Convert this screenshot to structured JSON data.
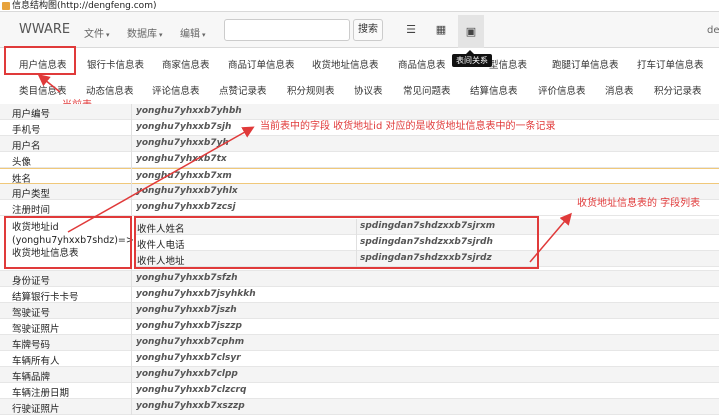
{
  "titlebar": {
    "title": "信息结构图(http://dengfeng.com)"
  },
  "navbar": {
    "brand": "WWARE",
    "menus": [
      "文件",
      "数据库",
      "编辑"
    ],
    "search_placeholder": "",
    "search_button": "搜索",
    "view_icons": [
      "list-icon",
      "grid-icon",
      "image-icon"
    ],
    "tooltip": "表间关系",
    "right_text": "de"
  },
  "tabs_row1": [
    "用户信息表",
    "银行卡信息表",
    "商家信息表",
    "商品订单信息表",
    "收货地址信息表",
    "商品信息表",
    "型信息表",
    "跑腿订单信息表",
    "打车订单信息表"
  ],
  "tabs_row2": [
    "类目信息表",
    "动态信息表",
    "评论信息表",
    "点赞记录表",
    "积分规则表",
    "协议表",
    "常见问题表",
    "结算信息表",
    "评价信息表",
    "消息表",
    "积分记录表"
  ],
  "annotations": {
    "current_table": "当前表",
    "field_note": "当前表中的字段 收货地址id 对应的是收货地址信息表中的一条记录",
    "field_list_note": "收货地址信息表的 字段列表"
  },
  "rows_top": [
    {
      "label": "用户编号",
      "value": "yonghu7yhxxb7yhbh"
    },
    {
      "label": "手机号",
      "value": "yonghu7yhxxb7sjh"
    },
    {
      "label": "用户名",
      "value": "yonghu7yhxxb7yh"
    },
    {
      "label": "头像",
      "value": "yonghu7yhxxb7tx"
    },
    {
      "label": "姓名",
      "value": "yonghu7yhxxb7xm"
    },
    {
      "label": "用户类型",
      "value": "yonghu7yhxxb7yhlx"
    },
    {
      "label": "注册时间",
      "value": "yonghu7yhxxb7zcsj"
    }
  ],
  "address_field": {
    "label": "收货地址id (yonghu7yhxxb7shdz)=> 收货地址信息表"
  },
  "nested_rows": [
    {
      "label": "收件人姓名",
      "value": "spdingdan7shdzxxb7sjrxm"
    },
    {
      "label": "收件人电话",
      "value": "spdingdan7shdzxxb7sjrdh"
    },
    {
      "label": "收件人地址",
      "value": "spdingdan7shdzxxb7sjrdz"
    }
  ],
  "rows_bottom": [
    {
      "label": "身份证号",
      "value": "yonghu7yhxxb7sfzh"
    },
    {
      "label": "结算银行卡卡号",
      "value": "yonghu7yhxxb7jsyhkkh"
    },
    {
      "label": "驾驶证号",
      "value": "yonghu7yhxxb7jszh"
    },
    {
      "label": "驾驶证照片",
      "value": "yonghu7yhxxb7jszzp"
    },
    {
      "label": "车牌号码",
      "value": "yonghu7yhxxb7cphm"
    },
    {
      "label": "车辆所有人",
      "value": "yonghu7yhxxb7clsyr"
    },
    {
      "label": "车辆品牌",
      "value": "yonghu7yhxxb7clpp"
    },
    {
      "label": "车辆注册日期",
      "value": "yonghu7yhxxb7clzcrq"
    },
    {
      "label": "行驶证照片",
      "value": "yonghu7yhxxb7xszzp"
    }
  ],
  "colors": {
    "annotation": "#e03a3a",
    "navbar_bg": "#f7f7f7"
  }
}
